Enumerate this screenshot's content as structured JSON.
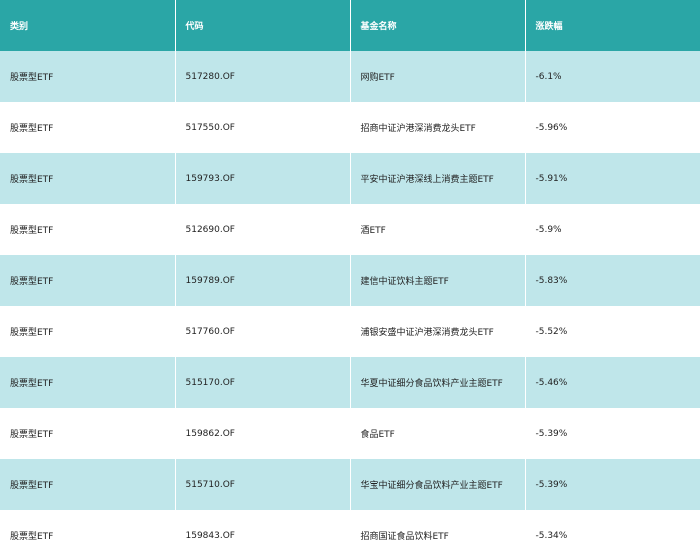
{
  "table": {
    "headers": [
      "类别",
      "代码",
      "基金名称",
      "涨跌幅"
    ],
    "rows": [
      {
        "type": "股票型ETF",
        "code": "517280.OF",
        "name": "网购ETF",
        "change": "-6.1%"
      },
      {
        "type": "股票型ETF",
        "code": "517550.OF",
        "name": "招商中证沪港深消费龙头ETF",
        "change": "-5.96%"
      },
      {
        "type": "股票型ETF",
        "code": "159793.OF",
        "name": "平安中证沪港深线上消费主题ETF",
        "change": "-5.91%"
      },
      {
        "type": "股票型ETF",
        "code": "512690.OF",
        "name": "酒ETF",
        "change": "-5.9%"
      },
      {
        "type": "股票型ETF",
        "code": "159789.OF",
        "name": "建信中证饮料主题ETF",
        "change": "-5.83%"
      },
      {
        "type": "股票型ETF",
        "code": "517760.OF",
        "name": "浦银安盛中证沪港深消费龙头ETF",
        "change": "-5.52%"
      },
      {
        "type": "股票型ETF",
        "code": "515170.OF",
        "name": "华夏中证细分食品饮料产业主题ETF",
        "change": "-5.46%"
      },
      {
        "type": "股票型ETF",
        "code": "159862.OF",
        "name": "食品ETF",
        "change": "-5.39%"
      },
      {
        "type": "股票型ETF",
        "code": "515710.OF",
        "name": "华宝中证细分食品饮料产业主题ETF",
        "change": "-5.39%"
      },
      {
        "type": "股票型ETF",
        "code": "159843.OF",
        "name": "招商国证食品饮料ETF",
        "change": "-5.34%"
      }
    ]
  },
  "colors": {
    "header_bg": "#2aa6a6",
    "row_alt_bg": "#bfe6ea",
    "row_bg": "#ffffff"
  }
}
